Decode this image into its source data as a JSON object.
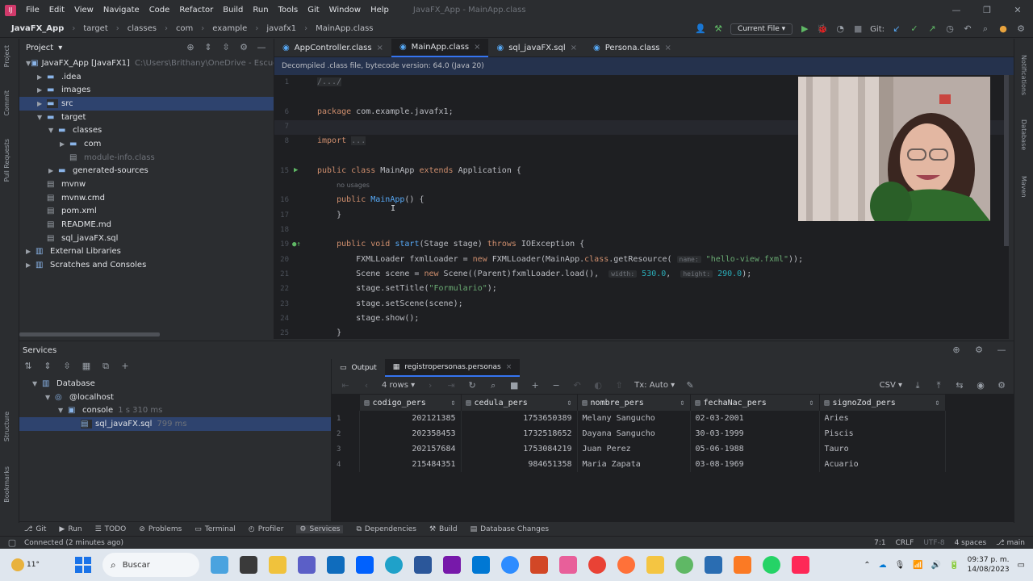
{
  "menu": {
    "items": [
      "File",
      "Edit",
      "View",
      "Navigate",
      "Code",
      "Refactor",
      "Build",
      "Run",
      "Tools",
      "Git",
      "Window",
      "Help"
    ],
    "window_title": "JavaFX_App - MainApp.class"
  },
  "nav": {
    "crumbs": [
      "JavaFX_App",
      "target",
      "classes",
      "com",
      "example",
      "javafx1",
      "MainApp.class"
    ],
    "current_file": "Current File",
    "git_label": "Git:"
  },
  "project": {
    "header": "Project",
    "tree": [
      {
        "label": "JavaFX_App [JavaFX1]",
        "path": "C:\\Users\\Brithany\\OneDrive - Escuela Po",
        "depth": 0,
        "arrow": "down",
        "kind": "module"
      },
      {
        "label": ".idea",
        "depth": 1,
        "arrow": "right",
        "kind": "folder"
      },
      {
        "label": "images",
        "depth": 1,
        "arrow": "right",
        "kind": "folder"
      },
      {
        "label": "src",
        "depth": 1,
        "arrow": "right",
        "kind": "folder",
        "selected": true
      },
      {
        "label": "target",
        "depth": 1,
        "arrow": "down",
        "kind": "folder"
      },
      {
        "label": "classes",
        "depth": 2,
        "arrow": "down",
        "kind": "folder"
      },
      {
        "label": "com",
        "depth": 3,
        "arrow": "right",
        "kind": "folder"
      },
      {
        "label": "module-info.class",
        "depth": 3,
        "arrow": "",
        "kind": "file",
        "dim": true
      },
      {
        "label": "generated-sources",
        "depth": 2,
        "arrow": "right",
        "kind": "folder"
      },
      {
        "label": "mvnw",
        "depth": 1,
        "arrow": "",
        "kind": "file"
      },
      {
        "label": "mvnw.cmd",
        "depth": 1,
        "arrow": "",
        "kind": "file"
      },
      {
        "label": "pom.xml",
        "depth": 1,
        "arrow": "",
        "kind": "file"
      },
      {
        "label": "README.md",
        "depth": 1,
        "arrow": "",
        "kind": "file"
      },
      {
        "label": "sql_javaFX.sql",
        "depth": 1,
        "arrow": "",
        "kind": "file"
      },
      {
        "label": "External Libraries",
        "depth": 0,
        "arrow": "right",
        "kind": "lib"
      },
      {
        "label": "Scratches and Consoles",
        "depth": 0,
        "arrow": "right",
        "kind": "lib"
      }
    ]
  },
  "tabs": [
    {
      "label": "AppController.class",
      "active": false
    },
    {
      "label": "MainApp.class",
      "active": true
    },
    {
      "label": "sql_javaFX.sql",
      "active": false
    },
    {
      "label": "Persona.class",
      "active": false
    }
  ],
  "banner": "Decompiled .class file, bytecode version: 64.0 (Java 20)",
  "editor": {
    "lines": [
      {
        "n": "1",
        "html": "<span class=\"fold\">/.../</span>"
      },
      {
        "n": "",
        "html": ""
      },
      {
        "n": "6",
        "html": "<span class=\"kw\">package</span> com.example.javafx1;"
      },
      {
        "n": "7",
        "html": "",
        "hl": true
      },
      {
        "n": "8",
        "html": "<span class=\"kw\">import</span> <span class=\"fold\">...</span>"
      },
      {
        "n": "",
        "html": ""
      },
      {
        "n": "15",
        "html": "<span class=\"kw\">public class</span> MainApp <span class=\"kw\">extends</span> Application {"
      },
      {
        "n": "",
        "html": "    <span class=\"usage\">no usages</span>"
      },
      {
        "n": "16",
        "html": "    <span class=\"kw\">public</span> <span class=\"fn\">MainApp</span>() {"
      },
      {
        "n": "17",
        "html": "    }"
      },
      {
        "n": "18",
        "html": ""
      },
      {
        "n": "19",
        "html": "    <span class=\"kw\">public void</span> <span class=\"fn\">start</span>(Stage stage) <span class=\"kw\">throws</span> IOException {"
      },
      {
        "n": "20",
        "html": "        FXMLLoader fxmlLoader = <span class=\"kw\">new</span> FXMLLoader(MainApp.<span class=\"kw\">class</span>.getResource( <span class=\"hint\">name:</span> <span class=\"str\">\"hello-view.fxml\"</span>));"
      },
      {
        "n": "21",
        "html": "        Scene scene = <span class=\"kw\">new</span> Scene((Parent)fxmlLoader.load(),  <span class=\"hint\">width:</span> <span class=\"num\">530.0</span>,  <span class=\"hint\">height:</span> <span class=\"num\">290.0</span>);"
      },
      {
        "n": "22",
        "html": "        stage.setTitle(<span class=\"str\">\"Formulario\"</span>);"
      },
      {
        "n": "23",
        "html": "        stage.setScene(scene);"
      },
      {
        "n": "24",
        "html": "        stage.show();"
      },
      {
        "n": "25",
        "html": "    }"
      }
    ]
  },
  "services": {
    "header": "Services",
    "tree": [
      {
        "label": "Database",
        "extra": "",
        "depth": 0
      },
      {
        "label": "@localhost",
        "extra": "",
        "depth": 1
      },
      {
        "label": "console",
        "extra": "1 s 310 ms",
        "depth": 2
      },
      {
        "label": "sql_javaFX.sql",
        "extra": "799 ms",
        "depth": 3,
        "selected": true
      }
    ],
    "result_tabs": [
      "Output",
      "registropersonas.personas"
    ],
    "rows_label": "4 rows",
    "tx_label": "Tx: Auto",
    "export_label": "CSV",
    "columns": [
      "codigo_pers",
      "cedula_pers",
      "nombre_pers",
      "fechaNac_pers",
      "signoZod_pers"
    ],
    "rows": [
      [
        "1",
        "202121385",
        "1753650389",
        "Melany Sangucho",
        "02-03-2001",
        "Aries"
      ],
      [
        "2",
        "202358453",
        "1732518652",
        "Dayana Sangucho",
        "30-03-1999",
        "Piscis"
      ],
      [
        "3",
        "202157684",
        "1753084219",
        "Juan Perez",
        "05-06-1988",
        "Tauro"
      ],
      [
        "4",
        "215484351",
        "984651358",
        "Maria Zapata",
        "03-08-1969",
        "Acuario"
      ]
    ]
  },
  "tool_tabs": [
    "Git",
    "Run",
    "TODO",
    "Problems",
    "Terminal",
    "Profiler",
    "Services",
    "Dependencies",
    "Build",
    "Database Changes"
  ],
  "status": {
    "left": "Connected (2 minutes ago)",
    "pos": "7:1",
    "eol": "CRLF",
    "enc": "UTF-8",
    "indent": "4 spaces",
    "branch": "main"
  },
  "taskbar": {
    "weather": "11°",
    "search": "Buscar",
    "time": "09:37 p. m.",
    "date": "14/08/2023"
  },
  "side_labels": {
    "left": [
      "Project",
      "Commit",
      "Pull Requests",
      "Structure",
      "Bookmarks"
    ],
    "right": [
      "Notifications",
      "Database",
      "Maven"
    ]
  }
}
